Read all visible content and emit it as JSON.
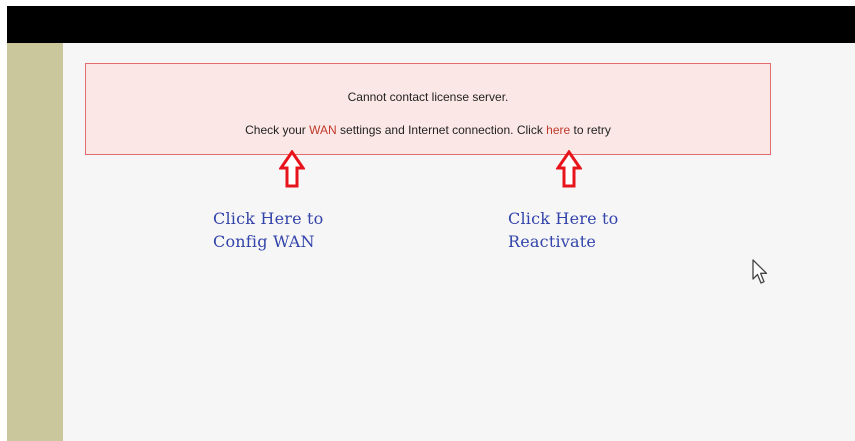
{
  "alert": {
    "line1": "Cannot contact license server.",
    "line2_prefix": "Check your ",
    "wan_link": "WAN",
    "line2_middle": " settings and Internet connection. Click ",
    "here_link": "here",
    "line2_suffix": " to retry"
  },
  "annotations": {
    "config_wan": "Click Here to\nConfig WAN",
    "reactivate": "Click Here to\nReactivate"
  },
  "icons": {
    "arrow": "up-arrow-icon",
    "cursor": "mouse-pointer-icon"
  },
  "colors": {
    "sidebar": "#c9c79b",
    "alert_bg": "#fbe8e6",
    "alert_border": "#e36b6b",
    "link": "#c0392b",
    "annotation": "#3344aa",
    "arrow": "#e8141b"
  }
}
